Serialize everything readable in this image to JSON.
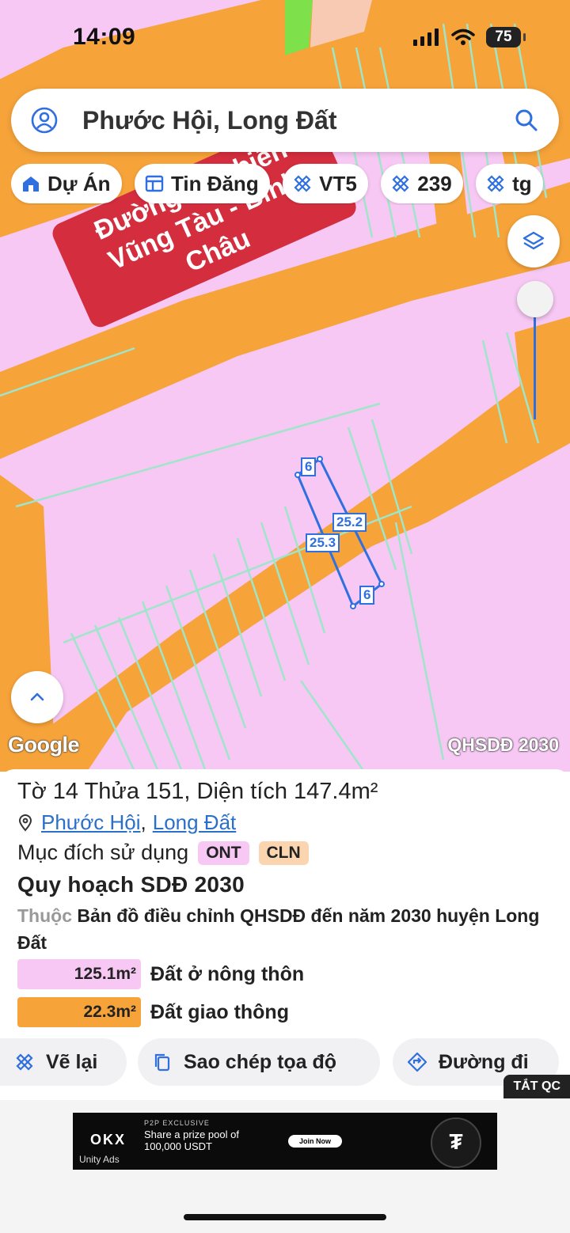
{
  "status": {
    "time": "14:09",
    "battery": "75"
  },
  "search": {
    "query": "Phước Hội, Long Đất"
  },
  "chips": [
    {
      "label": "Dự Án",
      "icon": "house-icon"
    },
    {
      "label": "Tin Đăng",
      "icon": "news-icon"
    },
    {
      "label": "VT5",
      "icon": "ruler-icon"
    },
    {
      "label": "239",
      "icon": "ruler-icon"
    },
    {
      "label": "tg",
      "icon": "ruler-icon"
    }
  ],
  "map": {
    "banner": "Đường ven biển Vũng Tàu - Bình Châu",
    "parcel_labels": {
      "top": "6",
      "bottom": "6",
      "left": "25.3",
      "right": "25.2"
    },
    "watermark": "Google",
    "plan_tag": "QHSDĐ 2030",
    "colors": {
      "residential": "#f7c8f4",
      "road": "#f6a33a",
      "parcel_lines": "#9fe5c9",
      "highlight": "#2f6fe0"
    }
  },
  "parcel": {
    "title": "Tờ 14 Thửa 151, Diện tích 147.4m²",
    "ward": "Phước Hội",
    "separator": ",",
    "district": "Long Đất",
    "purpose_label": "Mục đích sử dụng",
    "purpose_tags": [
      "ONT",
      "CLN"
    ],
    "plan_heading": "Quy hoạch SDĐ 2030",
    "belongs_prefix": "Thuộc",
    "belongs_text": "Bản đồ điều chỉnh QHSDĐ đến năm 2030 huyện Long Đất",
    "areas": [
      {
        "value": "125.1m²",
        "label": "Đất ở nông thôn",
        "color": "#f7c8f4"
      },
      {
        "value": "22.3m²",
        "label": "Đất giao thông",
        "color": "#f6a33a"
      }
    ]
  },
  "actions": {
    "redraw": "Vẽ lại",
    "copy_coords": "Sao chép tọa độ",
    "directions": "Đường đi",
    "close_ads": "TẮT QC"
  },
  "ad": {
    "kicker": "P2P EXCLUSIVE",
    "message": "Share a prize pool of 100,000 USDT",
    "cta": "Join Now",
    "brand": "OKX",
    "network": "Unity Ads"
  }
}
